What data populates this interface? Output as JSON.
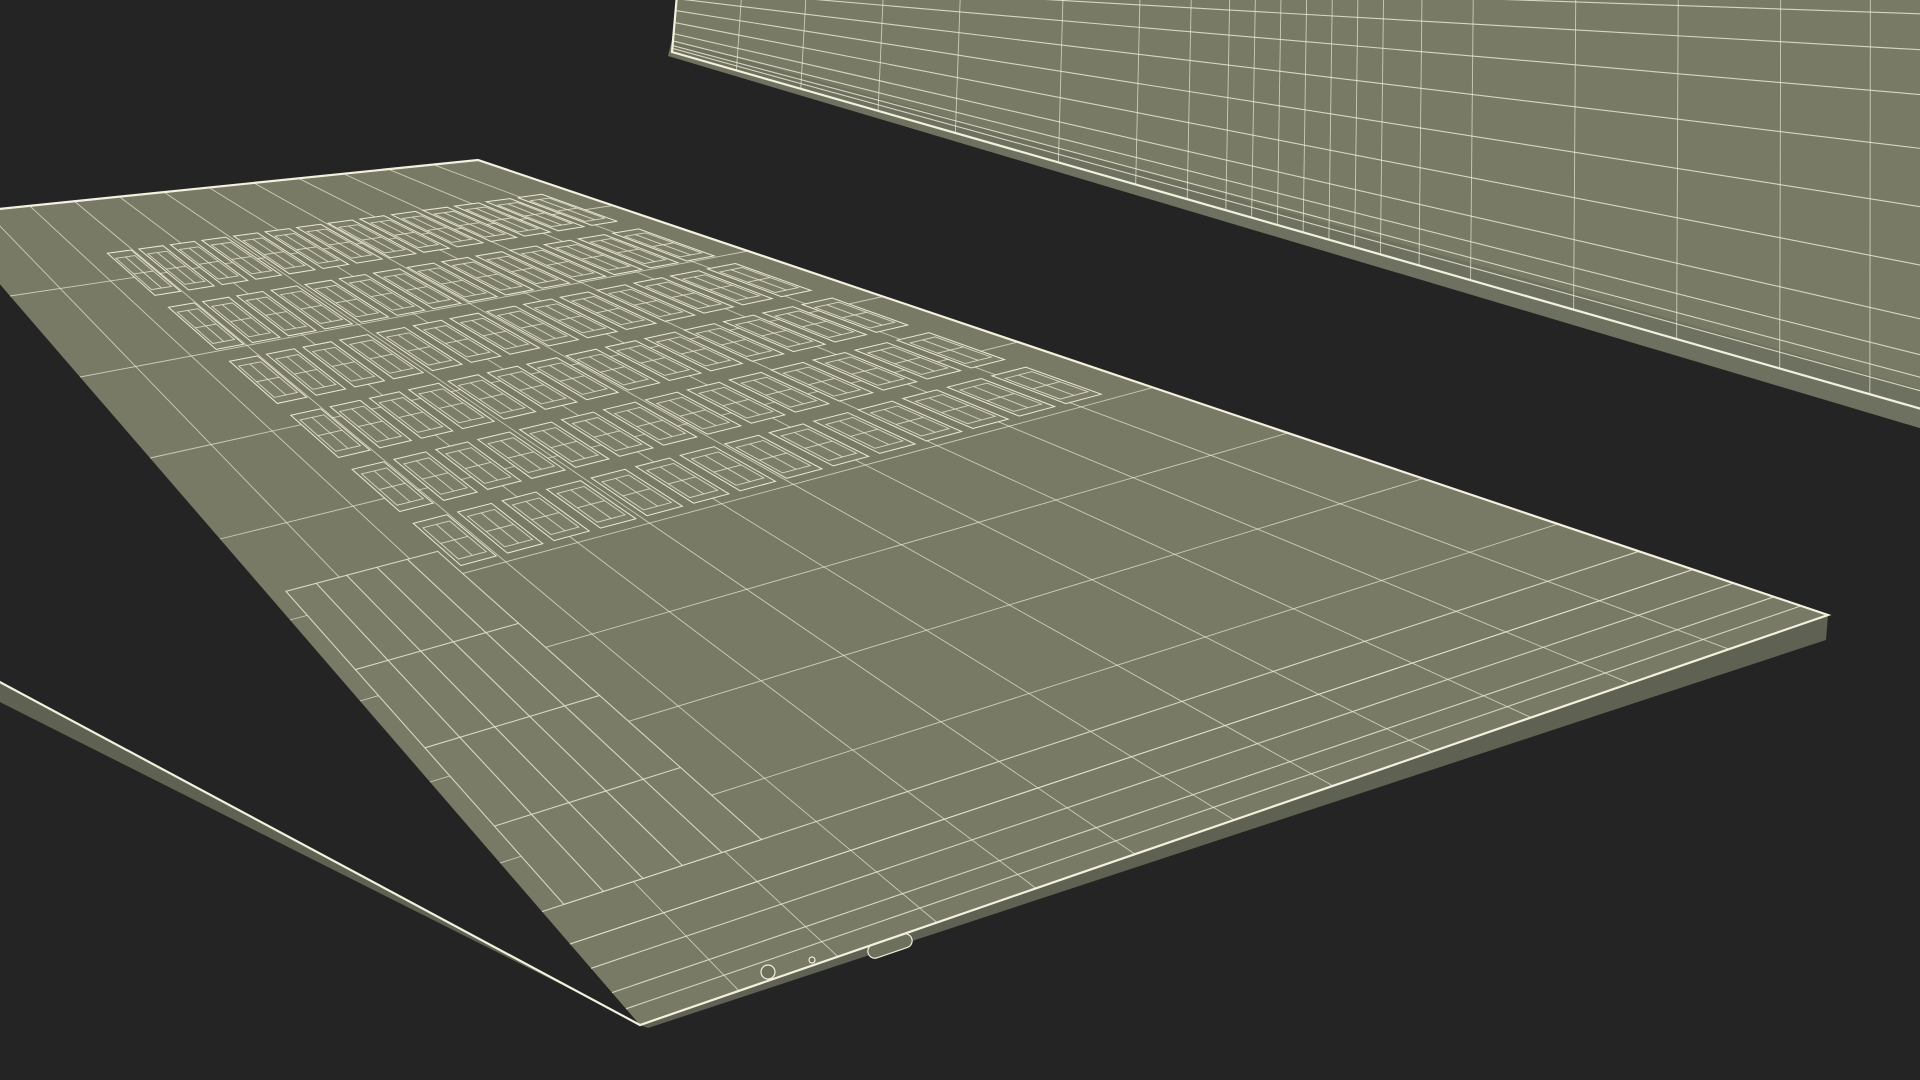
{
  "scene": {
    "background": "#242424",
    "surface_color": "#787a66",
    "wireframe_color": "#e9e6cf",
    "objects": [
      "laptop-base",
      "laptop-lid"
    ]
  },
  "laptop_base": {
    "key_rows": 6,
    "key_columns": 14,
    "ports": [
      "usb-c-port",
      "led-indicator",
      "audio-jack"
    ]
  }
}
